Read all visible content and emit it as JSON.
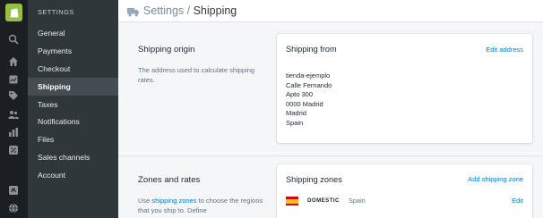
{
  "rail": {
    "icons": [
      "shopify-logo-icon",
      "search-icon",
      "home-icon",
      "orders-icon",
      "tag-icon",
      "customers-icon",
      "reports-icon",
      "discounts-icon",
      "apps-icon",
      "globe-icon"
    ]
  },
  "nav": {
    "heading": "SETTINGS",
    "items": [
      {
        "label": "General"
      },
      {
        "label": "Payments"
      },
      {
        "label": "Checkout"
      },
      {
        "label": "Shipping"
      },
      {
        "label": "Taxes"
      },
      {
        "label": "Notifications"
      },
      {
        "label": "Files"
      },
      {
        "label": "Sales channels"
      },
      {
        "label": "Account"
      }
    ],
    "active_item": "Shipping"
  },
  "header": {
    "breadcrumb_parent": "Settings",
    "separator": " / ",
    "breadcrumb_current": "Shipping"
  },
  "origin": {
    "title": "Shipping origin",
    "description": "The address used to calculate shipping rates.",
    "card": {
      "title": "Shipping from",
      "action": "Edit address",
      "address_lines": [
        "tienda-ejemplo",
        "Calle Fernando",
        "Apto 300",
        "0000 Madrid",
        "Madrid",
        "Spain"
      ]
    }
  },
  "zones": {
    "title": "Zones and rates",
    "description_prefix": "Use ",
    "description_link": "shipping zones",
    "description_suffix": " to choose the regions that you ship to. Define",
    "card": {
      "title": "Shipping zones",
      "action": "Add shipping zone",
      "rows": [
        {
          "name": "DOMESTIC",
          "country": "Spain",
          "action": "Edit",
          "flag": "spain-flag"
        }
      ]
    }
  },
  "colors": {
    "rail_bg": "#1b1f23",
    "nav_bg": "#30373b",
    "nav_active_bg": "#454d53",
    "link": "#007ace",
    "brand_green": "#95bf47"
  }
}
